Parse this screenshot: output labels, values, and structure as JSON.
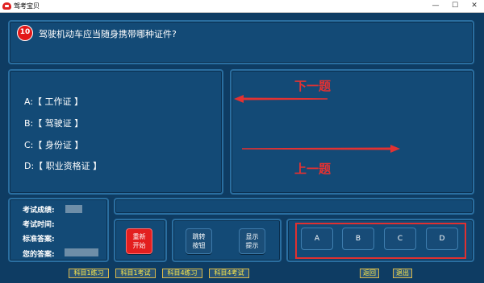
{
  "window": {
    "title": "驾考宝贝",
    "minimize": "—",
    "maximize": "☐",
    "close": "✕"
  },
  "question": {
    "number": "10",
    "text": "驾驶机动车应当随身携带哪种证件?"
  },
  "options": [
    {
      "label": "A:【 工作证 】"
    },
    {
      "label": "B:【 驾驶证 】"
    },
    {
      "label": "C:【 身份证 】"
    },
    {
      "label": "D:【 职业资格证 】"
    }
  ],
  "nav_hints": {
    "next": "下一题",
    "prev": "上一题"
  },
  "status": {
    "score_label": "考试成绩:",
    "time_label": "考试时间:",
    "standard_label": "标准答案:",
    "your_label": "您的答案:"
  },
  "controls": {
    "restart": [
      "重新",
      "开始"
    ],
    "jump": [
      "跳转",
      "按钮"
    ],
    "hint": [
      "显示",
      "提示"
    ]
  },
  "answers": [
    "A",
    "B",
    "C",
    "D"
  ],
  "footer": {
    "s1_practice": "科目1练习",
    "s1_exam": "科目1考试",
    "s4_practice": "科目4练习",
    "s4_exam": "科目4考试",
    "back": "返回",
    "exit": "退出"
  },
  "colors": {
    "accent_red": "#e31818",
    "panel": "#134a76",
    "border": "#2a6ea0"
  }
}
